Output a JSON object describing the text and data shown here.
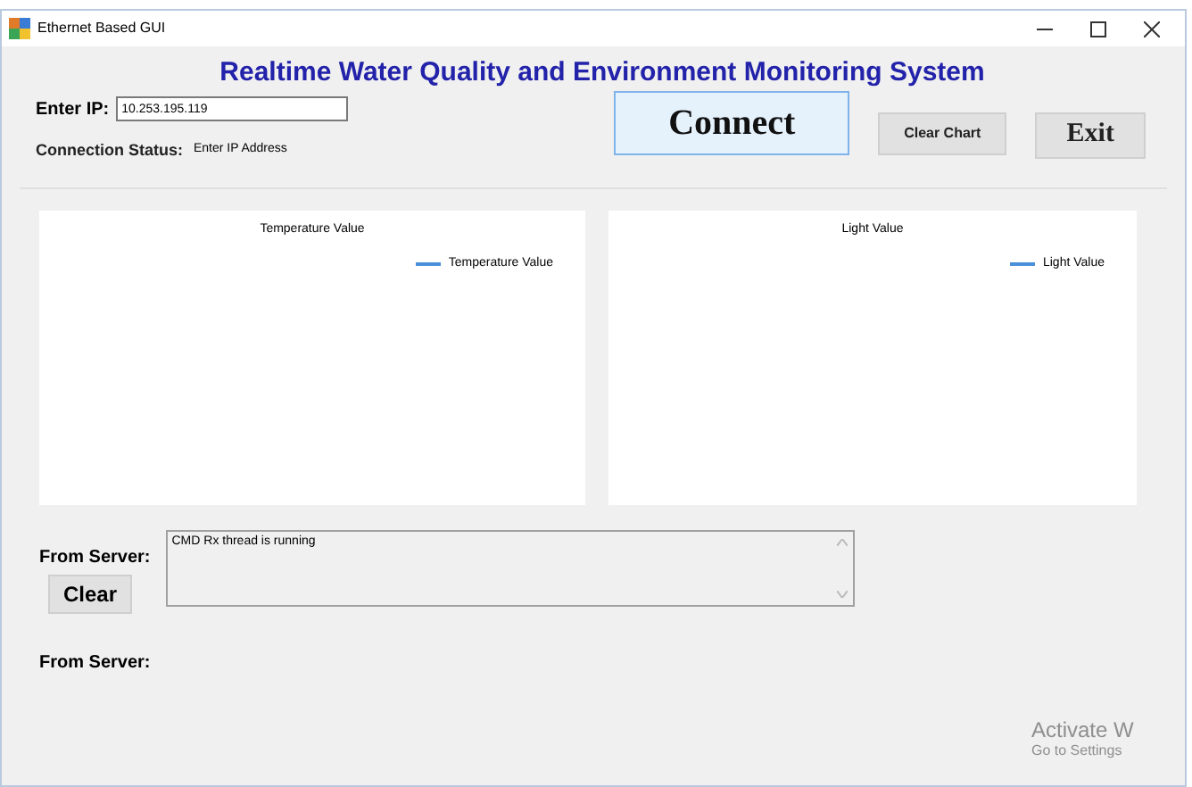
{
  "window": {
    "title": "Ethernet Based GUI"
  },
  "heading": "Realtime Water Quality and Environment Monitoring System",
  "ip": {
    "label": "Enter IP:",
    "value": "10.253.195.119"
  },
  "status": {
    "label": "Connection Status:",
    "value": "Enter IP Address"
  },
  "buttons": {
    "connect": "Connect",
    "clear_chart": "Clear Chart",
    "exit": "Exit"
  },
  "charts": [
    {
      "title": "Temperature Value",
      "legend": "Temperature Value"
    },
    {
      "title": "Light Value",
      "legend": "Light Value"
    }
  ],
  "server_log": {
    "label": "From Server:",
    "clear": "Clear",
    "text": "CMD Rx thread is running"
  },
  "server_label_2": "From Server:",
  "watermark": {
    "line_1": "Activate W",
    "line_2": "Go to Settings"
  }
}
